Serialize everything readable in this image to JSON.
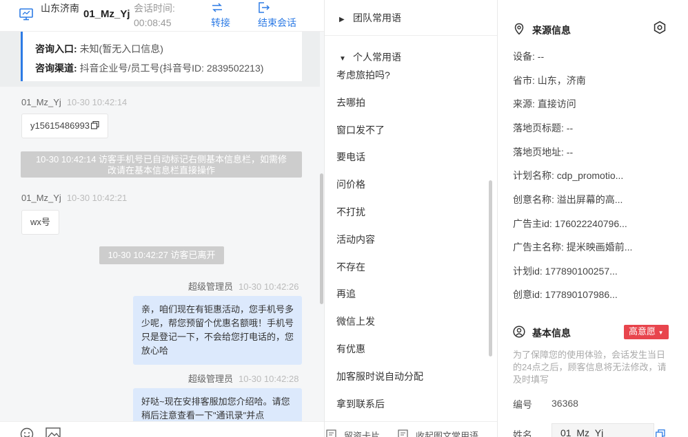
{
  "header": {
    "location": "山东济南",
    "visitor_name": "01_Mz_Yj",
    "session_time_label": "会话时间:",
    "session_time": "00:08:45",
    "transfer_label": "转接",
    "end_label": "结束会话"
  },
  "entry_info": {
    "entry_label": "咨询入口:",
    "entry_value": "未知(暂无入口信息)",
    "channel_label": "咨询渠道:",
    "channel_value": "抖音企业号/员工号(抖音号ID:  2839502213)"
  },
  "messages": {
    "m1_sender": "01_Mz_Yj",
    "m1_time": "10-30 10:42:14",
    "m1_text": "y15615486993",
    "sys1_line1": "10-30 10:42:14 访客手机号已自动标记右侧基本信息栏，如需修",
    "sys1_line2": "改请在基本信息栏直接操作",
    "m2_sender": "01_Mz_Yj",
    "m2_time": "10-30 10:42:21",
    "m2_text": "wx号",
    "sys2": "10-30 10:42:27 访客已离开",
    "m3_sender": "超级管理员",
    "m3_time": "10-30 10:42:26",
    "m3_text": "亲，咱们现在有钜惠活动，您手机号多少呢，帮您预留个优惠名额哦！手机号只是登记一下，不会给您打电话的，您放心哈",
    "m4_sender": "超级管理员",
    "m4_time": "10-30 10:42:28",
    "m4_text": "好哒~现在安排客服加您介绍哈。请您稍后注意查看一下\"通讯录\"并点"
  },
  "phrases": {
    "team_group": "团队常用语",
    "personal_group": "个人常用语",
    "items": [
      "考虑旅拍吗?",
      "去哪拍",
      "窗口发不了",
      "要电话",
      "问价格",
      "不打扰",
      "活动内容",
      "不存在",
      "再追",
      "微信上发",
      "有优惠",
      "加客服时说自动分配",
      "拿到联系后"
    ],
    "footer_left": "留资卡片",
    "footer_right": "收起图文常用语"
  },
  "source_info": {
    "title": "来源信息",
    "device": "设备: --",
    "province_city": "省市:  山东，济南",
    "source": "来源:  直接访问",
    "landing_title": "落地页标题:  --",
    "landing_url": "落地页地址:  --",
    "plan_name": "计划名称:  cdp_promotio...",
    "creative_name": "创意名称:  溢出屏幕的高...",
    "advertiser_id": "广告主id:  176022240796...",
    "advertiser_name": "广告主名称:  提米映画婚前...",
    "plan_id": "计划id:  177890100257...",
    "creative_id": "创意id:  177890107986..."
  },
  "basic_info": {
    "title": "基本信息",
    "intent_badge": "高意愿",
    "notice": "为了保障您的使用体验，会话发生当日的24点之后，顾客信息将无法修改，请及时填写",
    "id_label": "编号",
    "id_value": "36368",
    "name_label": "姓名",
    "name_value": "01_Mz_Yj"
  },
  "colors": {
    "accent": "#2d7be5",
    "badge": "#e8454d",
    "bubble_blue": "#dce9fc"
  }
}
